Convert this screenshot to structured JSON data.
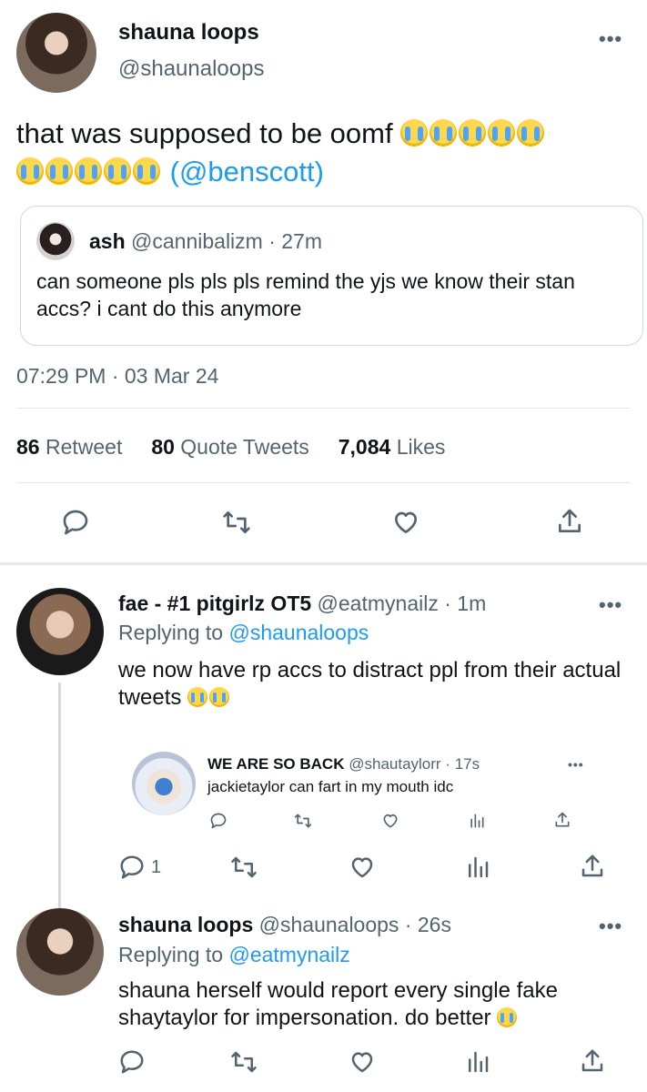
{
  "main_tweet": {
    "display_name": "shauna loops",
    "handle": "@shaunaloops",
    "text": "that was supposed to be oomf",
    "mention": "(@benscott)",
    "more_icon": "more-horizontal-icon",
    "quoted": {
      "display_name": "ash",
      "handle": "@cannibalizm",
      "time": "· 27m",
      "text": "can someone pls pls pls remind the yjs we know their stan accs? i cant do this anymore"
    },
    "timestamp": "07:29 PM · 03 Mar 24",
    "stats": {
      "retweets_count": "86",
      "retweets_label": "Retweet",
      "quotes_count": "80",
      "quotes_label": "Quote Tweets",
      "likes_count": "7,084",
      "likes_label": "Likes"
    }
  },
  "replies": [
    {
      "display_name": "fae - #1 pitgirlz OT5",
      "handle": "@eatmynailz",
      "time": "· 1m",
      "replying_to_label": "Replying to",
      "replying_to": "@shaunaloops",
      "text": "we now have rp accs to distract ppl from their actual tweets",
      "reply_count": "1",
      "embedded": {
        "display_name": "WE ARE SO BACK",
        "handle": "@shautaylorr",
        "time": "· 17s",
        "text": "jackietaylor can fart in my mouth idc"
      }
    },
    {
      "display_name": "shauna loops",
      "handle": "@shaunaloops",
      "time": "· 26s",
      "replying_to_label": "Replying to",
      "replying_to": "@eatmynailz",
      "text": "shauna herself would report every single fake shaytaylor for impersonation. do better"
    }
  ],
  "colors": {
    "accent": "#1d9bf0",
    "text": "#0f1419",
    "muted": "#536471",
    "divider": "#e6e9ec"
  }
}
